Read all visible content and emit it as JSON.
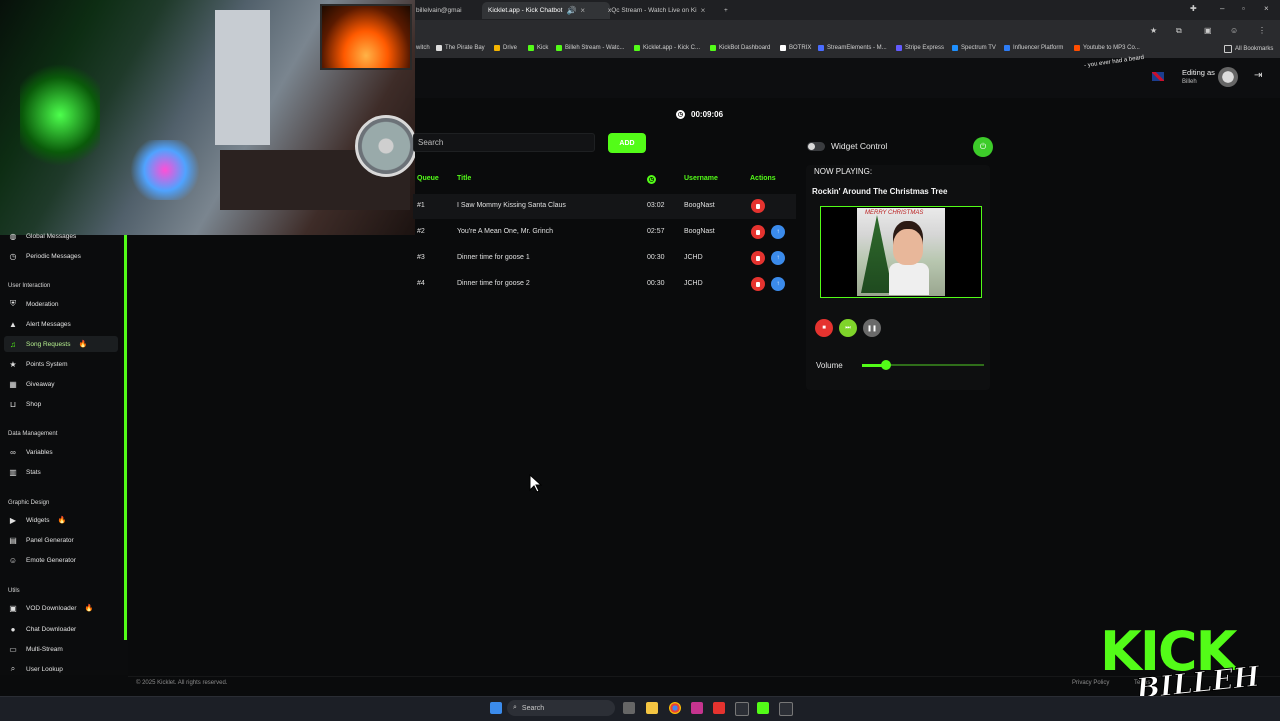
{
  "browser": {
    "tabs": [
      {
        "label": "billelvain@gmai",
        "active": false
      },
      {
        "label": "Kicklet.app - Kick Chatbot",
        "active": true
      },
      {
        "label": "xQc Stream - Watch Live on Ki",
        "active": false
      }
    ],
    "bookmarks": [
      "witch",
      "The Pirate Bay",
      "Drive",
      "Kick",
      "Billeh Stream - Watc...",
      "Kicklet.app - Kick C...",
      "KickBot Dashboard",
      "BOTRIX",
      "StreamElements - M...",
      "Stripe Express",
      "Spectrum TV",
      "Influencer Platform",
      "Youtube to MP3 Co...",
      "All Bookmarks"
    ]
  },
  "header": {
    "editing_label": "Editing as",
    "editing_user": "Billeh",
    "chat_overlay": "- you ever had a beard"
  },
  "sidebar": {
    "partial_items": [
      {
        "label": "Global Messages",
        "icon": "globe-icon"
      },
      {
        "label": "Periodic Messages",
        "icon": "clock-icon"
      }
    ],
    "sections": [
      {
        "title": "User Interaction",
        "items": [
          {
            "label": "Moderation",
            "icon": "shield-icon"
          },
          {
            "label": "Alert Messages",
            "icon": "warning-icon"
          },
          {
            "label": "Song Requests",
            "icon": "music-icon",
            "active": true,
            "flame": true
          },
          {
            "label": "Points System",
            "icon": "star-icon"
          },
          {
            "label": "Giveaway",
            "icon": "gift-icon"
          },
          {
            "label": "Shop",
            "icon": "cart-icon"
          }
        ]
      },
      {
        "title": "Data Management",
        "items": [
          {
            "label": "Variables",
            "icon": "link-icon"
          },
          {
            "label": "Stats",
            "icon": "bar-chart-icon"
          }
        ]
      },
      {
        "title": "Graphic Design",
        "items": [
          {
            "label": "Widgets",
            "icon": "video-icon",
            "flame": true
          },
          {
            "label": "Panel Generator",
            "icon": "panel-icon"
          },
          {
            "label": "Emote Generator",
            "icon": "smiley-icon"
          }
        ]
      },
      {
        "title": "Utils",
        "items": [
          {
            "label": "VOD Downloader",
            "icon": "film-icon",
            "flame": true
          },
          {
            "label": "Chat Downloader",
            "icon": "chat-icon"
          },
          {
            "label": "Multi-Stream",
            "icon": "monitor-icon"
          },
          {
            "label": "User Lookup",
            "icon": "search-icon"
          }
        ]
      }
    ]
  },
  "queue": {
    "timer": "00:09:06",
    "search_placeholder": "Search",
    "add_label": "ADD",
    "columns": {
      "queue": "Queue",
      "title": "Title",
      "username": "Username",
      "actions": "Actions"
    },
    "rows": [
      {
        "queue": "#1",
        "title": "I Saw Mommy Kissing Santa Claus",
        "duration": "03:02",
        "username": "BoogNast"
      },
      {
        "queue": "#2",
        "title": "You're A Mean One, Mr. Grinch",
        "duration": "02:57",
        "username": "BoogNast"
      },
      {
        "queue": "#3",
        "title": "Dinner time for goose 1",
        "duration": "00:30",
        "username": "JCHD"
      },
      {
        "queue": "#4",
        "title": "Dinner time for goose 2",
        "duration": "00:30",
        "username": "JCHD"
      }
    ]
  },
  "player": {
    "widget_control_label": "Widget Control",
    "now_playing_label": "NOW PLAYING:",
    "song_title": "Rockin' Around The Christmas Tree",
    "cover_text": "MERRY CHRISTMAS",
    "volume_label": "Volume",
    "volume_fraction": 0.2
  },
  "footer": {
    "copyright": "© 2025 Kicklet. All rights reserved.",
    "privacy": "Privacy Policy",
    "terms": "Terms o"
  },
  "overlay": {
    "logo_word": "KICK",
    "signature": "BILLEH"
  },
  "taskbar": {
    "search_label": "Search"
  },
  "colors": {
    "accent": "#53fc18",
    "delete": "#e5332f",
    "move": "#3b8beb"
  }
}
